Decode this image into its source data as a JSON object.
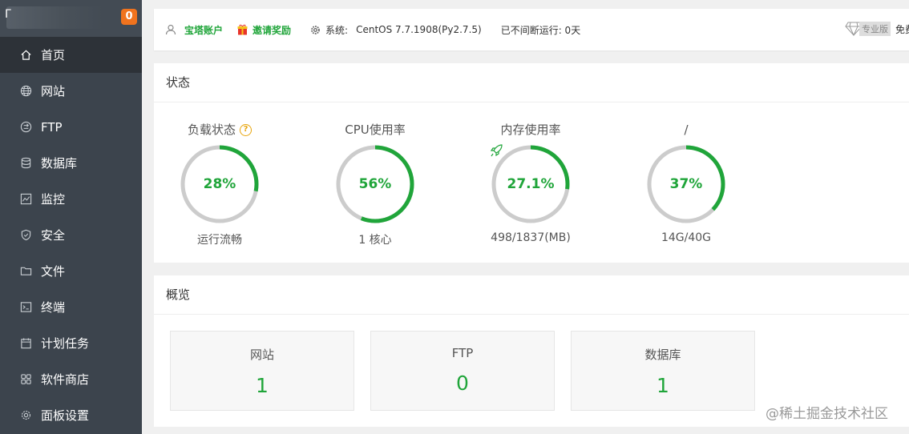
{
  "sidebar": {
    "logo_text": "Γ",
    "badge": "0",
    "items": [
      {
        "label": "首页",
        "icon": "home-icon"
      },
      {
        "label": "网站",
        "icon": "globe-icon"
      },
      {
        "label": "FTP",
        "icon": "ftp-icon"
      },
      {
        "label": "数据库",
        "icon": "database-icon"
      },
      {
        "label": "监控",
        "icon": "monitor-icon"
      },
      {
        "label": "安全",
        "icon": "shield-icon"
      },
      {
        "label": "文件",
        "icon": "folder-icon"
      },
      {
        "label": "终端",
        "icon": "terminal-icon"
      },
      {
        "label": "计划任务",
        "icon": "calendar-icon"
      },
      {
        "label": "软件商店",
        "icon": "grid-icon"
      },
      {
        "label": "面板设置",
        "icon": "gear-icon"
      }
    ]
  },
  "topbar": {
    "account": "宝塔账户",
    "invite": "邀请奖励",
    "system_label": "系统:",
    "system_value": "CentOS 7.7.1908(Py2.7.5)",
    "uptime": "已不间断运行: 0天",
    "pro_tag": "专业版",
    "free_text": "免费"
  },
  "status": {
    "title": "状态",
    "gauges": [
      {
        "title": "负载状态",
        "value": "28%",
        "percent": 0.28,
        "sub": "运行流畅",
        "help": "?"
      },
      {
        "title": "CPU使用率",
        "value": "56%",
        "percent": 0.56,
        "sub": "1 核心"
      },
      {
        "title": "内存使用率",
        "value": "27.1%",
        "percent": 0.271,
        "sub": "498/1837(MB)"
      },
      {
        "title": "/",
        "value": "37%",
        "percent": 0.37,
        "sub": "14G/40G"
      }
    ]
  },
  "overview": {
    "title": "概览",
    "cards": [
      {
        "label": "网站",
        "value": "1"
      },
      {
        "label": "FTP",
        "value": "0"
      },
      {
        "label": "数据库",
        "value": "1"
      }
    ]
  },
  "colors": {
    "accent": "#20a53a",
    "sidebar_bg": "#3c444d",
    "badge": "#f0731e",
    "ring_track": "#cccccc"
  },
  "watermark": "@稀土掘金技术社区"
}
